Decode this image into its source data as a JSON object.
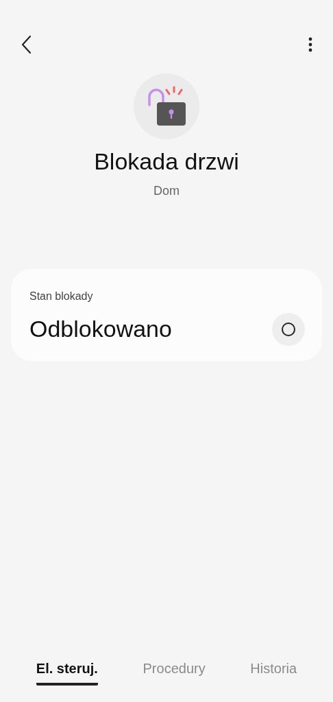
{
  "device": {
    "title": "Blokada drzwi",
    "location": "Dom"
  },
  "lock_card": {
    "label": "Stan blokady",
    "value": "Odblokowano"
  },
  "tabs": [
    {
      "label": "El. steruj.",
      "selected": true
    },
    {
      "label": "Procedury",
      "selected": false
    },
    {
      "label": "Historia",
      "selected": false
    }
  ]
}
